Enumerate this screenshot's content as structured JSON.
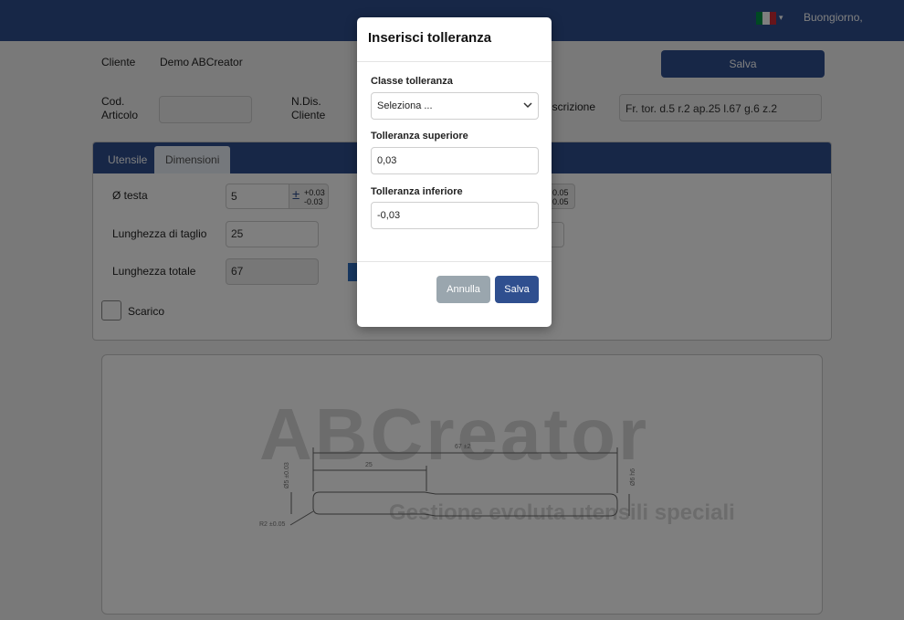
{
  "header": {
    "greeting": "Buongiorno,"
  },
  "flag_colors": [
    "#009246",
    "#ffffff",
    "#ce2b37"
  ],
  "form": {
    "cliente_label": "Cliente",
    "cliente_value": "Demo ABCreator",
    "cod_articolo_label_1": "Cod.",
    "cod_articolo_label_2": "Articolo",
    "ndis_label_1": "N.Dis.",
    "ndis_label_2": "Cliente",
    "descrizione_label": "escrizione",
    "descrizione_value": "Fr. tor. d.5 r.2 ap.25 l.67 g.6 z.2",
    "save_label": "Salva"
  },
  "tabs": [
    {
      "label": "Utensile"
    },
    {
      "label": "Dimensioni"
    }
  ],
  "dimensions": {
    "testa_label": "Ø testa",
    "testa_value": "5",
    "testa_tol_up": "+0.03",
    "testa_tol_down": "-0.03",
    "taglio_label": "Lunghezza di taglio",
    "taglio_value": "25",
    "totale_label": "Lunghezza totale",
    "totale_value": "67",
    "right_tol_up": "0.05",
    "right_tol_down": "0.05",
    "scarico_label": "Scarico"
  },
  "drawing": {
    "logo": "ABCreator",
    "tagline": "Gestione evoluta utensili speciali",
    "dim_total": "67 ±2",
    "dim_cut": "25",
    "dim_diameter": "Ø5 ±0.03",
    "dim_shank": "Ø6 h6",
    "dim_radius": "R2 ±0.05"
  },
  "modal": {
    "title": "Inserisci tolleranza",
    "classe_label": "Classe tolleranza",
    "classe_selected": "Seleziona ...",
    "sup_label": "Tolleranza superiore",
    "sup_value": "0,03",
    "inf_label": "Tolleranza inferiore",
    "inf_value": "-0,03",
    "cancel_label": "Annulla",
    "save_label": "Salva"
  }
}
